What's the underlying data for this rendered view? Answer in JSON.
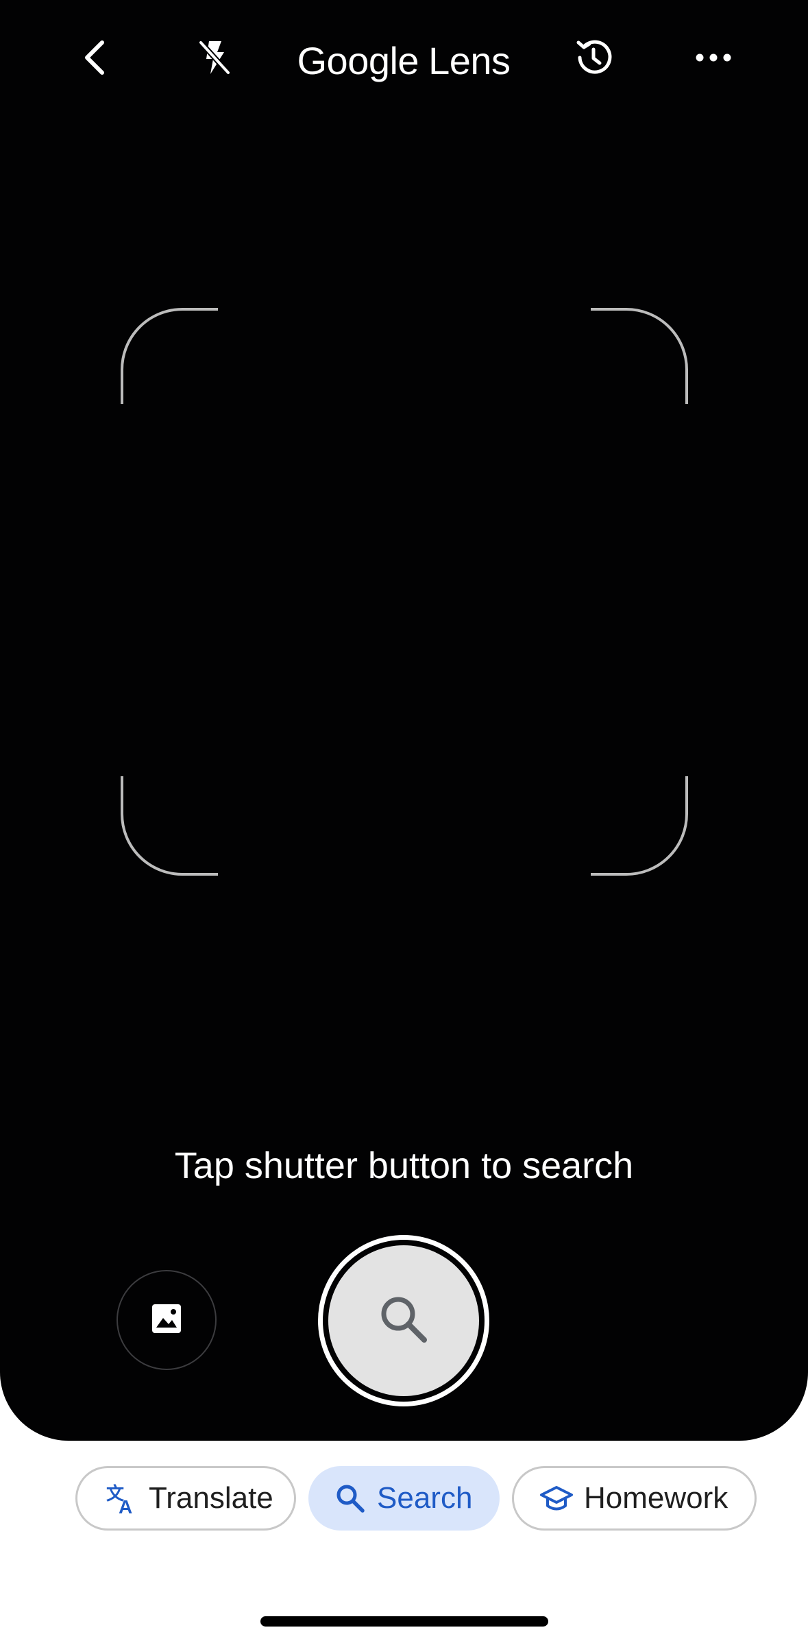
{
  "topbar": {
    "back_icon": "chevron-left-icon",
    "flash_icon": "flash-off-icon",
    "title_brand": "Google",
    "title_product": "Lens",
    "history_icon": "history-icon",
    "more_icon": "more-horizontal-icon"
  },
  "viewfinder": {
    "hint": "Tap shutter button to search"
  },
  "controls": {
    "gallery_icon": "image-icon",
    "shutter_icon": "search-icon"
  },
  "modes": [
    {
      "label": "Translate",
      "icon": "translate-icon",
      "selected": false
    },
    {
      "label": "Search",
      "icon": "search-icon",
      "selected": true
    },
    {
      "label": "Homework",
      "icon": "homework-icon",
      "selected": false
    }
  ],
  "colors": {
    "viewfinder_bg": "#020203",
    "active_chip_bg": "#d9e5fb",
    "active_chip_text": "#1f5bc6",
    "chip_border": "#c8c8c8"
  }
}
